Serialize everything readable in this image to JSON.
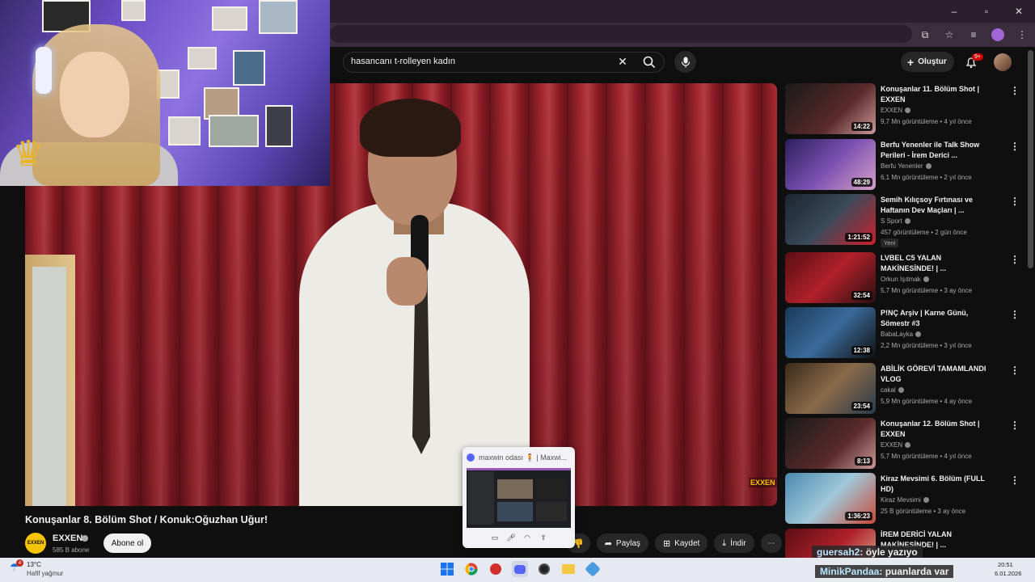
{
  "browser": {
    "window_controls": [
      "–",
      "▫",
      "✕"
    ]
  },
  "header": {
    "search_query": "hasancanı t-rolleyen kadın",
    "create_label": "Oluştur",
    "notification_count": "9+"
  },
  "video": {
    "title": "Konuşanlar 8. Bölüm Shot / Konuk:Oğuzhan Uğur!",
    "watermark": "EXXEN",
    "channel": {
      "name": "EXXEN",
      "subscribers": "585 B abone",
      "avatar_text": "EXXEN"
    },
    "subscribe_label": "Abone ol",
    "actions": {
      "share": "Paylaş",
      "save": "Kaydet",
      "download": "İndir"
    }
  },
  "recommendations": [
    {
      "title": "Konuşanlar 11. Bölüm Shot | EXXEN",
      "channel": "EXXEN",
      "meta": "9,7 Mn görüntüleme • 4 yıl önce",
      "duration": "14:22"
    },
    {
      "title": "Berfu Yenenler ile Talk Show Perileri - İrem Derici ...",
      "channel": "Berfu Yenenler",
      "meta": "6,1 Mn görüntüleme • 2 yıl önce",
      "duration": "48:29"
    },
    {
      "title": "Semih Kılıçsoy Fırtınası ve Haftanın Dev Maçları | ...",
      "channel": "S Sport",
      "meta": "457 görüntüleme • 2 gün önce",
      "duration": "1:21:52",
      "badge": "Yeni"
    },
    {
      "title": "LVBEL C5 YALAN MAKİNESİNDE! | ...",
      "channel": "Orkun Işıtmak",
      "meta": "5,7 Mn görüntüleme • 3 ay önce",
      "duration": "32:54"
    },
    {
      "title": "P!NÇ Arşiv | Karne Günü, Sömestr #3",
      "channel": "BabaLayka",
      "meta": "2,2 Mn görüntüleme • 3 yıl önce",
      "duration": "12:38"
    },
    {
      "title": "ABİLİK GÖREVİ TAMAMLANDI VLOG",
      "channel": "cakal",
      "meta": "5,9 Mn görüntüleme • 4 ay önce",
      "duration": "23:54"
    },
    {
      "title": "Konuşanlar 12. Bölüm Shot | EXXEN",
      "channel": "EXXEN",
      "meta": "5,7 Mn görüntüleme • 4 yıl önce",
      "duration": "8:13"
    },
    {
      "title": "Kiraz Mevsimi 6. Bölüm (FULL HD)",
      "channel": "Kiraz Mevsimi",
      "meta": "25 B görüntüleme • 3 ay önce",
      "duration": "1:36:23"
    },
    {
      "title": "İREM DERİCİ YALAN MAKİNESİNDE! | ...",
      "channel": "",
      "meta": "",
      "duration": ""
    }
  ],
  "popup": {
    "title": "maxwin odası 🧍 | Maxwi..."
  },
  "chat": [
    {
      "user": "guersah2",
      "message": ": öyle yazıyo"
    },
    {
      "user": "MinikPandaa",
      "message": ": puanlarda var"
    }
  ],
  "taskbar": {
    "weather_badge": "4",
    "temperature": "13°C",
    "weather": "Hafif yağmur",
    "time": "20:51",
    "date": "6.01.2026"
  },
  "colors": {
    "accent_yellow": "#f5c400",
    "badge_red": "#cc0000",
    "background": "#0f0f0f"
  }
}
